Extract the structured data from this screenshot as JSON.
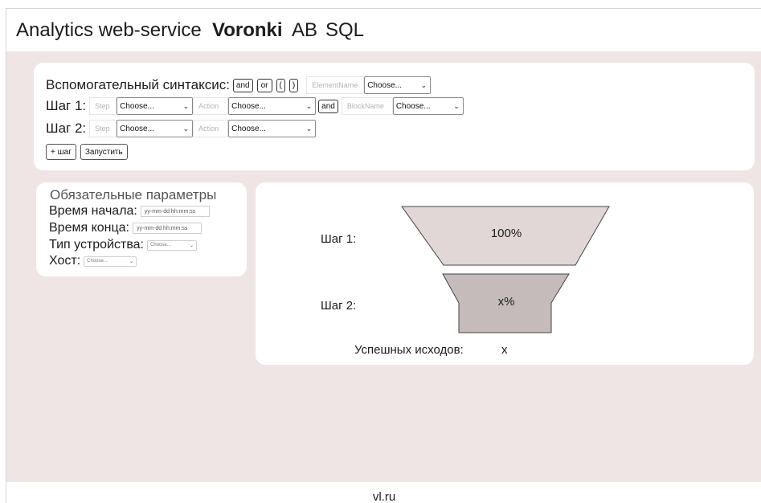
{
  "header": {
    "brand": "Analytics web-service",
    "nav": [
      {
        "label": "Voronki",
        "active": true
      },
      {
        "label": "AB",
        "active": false
      },
      {
        "label": "SQL",
        "active": false
      }
    ]
  },
  "syntax": {
    "label": "Вспомогательный синтаксис:",
    "buttons": [
      "and",
      "or",
      "(",
      ")"
    ],
    "element_placeholder": "ElementName",
    "element_select": "Choose..."
  },
  "steps": [
    {
      "label": "Шаг 1:",
      "step_placeholder": "Step",
      "step_select": "Choose...",
      "action_placeholder": "Action",
      "action_select": "Choose...",
      "connector": "and",
      "block_placeholder": "BlockName",
      "block_select": "Choose..."
    },
    {
      "label": "Шаг 2:",
      "step_placeholder": "Step",
      "step_select": "Choose...",
      "action_placeholder": "Action",
      "action_select": "Choose..."
    }
  ],
  "actions": {
    "add_step": "+ шаг",
    "run": "Запустить"
  },
  "params": {
    "title": "Обязательные параметры",
    "start_label": "Время начала:",
    "start_placeholder": "yy-mm-dd hh:mm:ss",
    "end_label": "Время конца:",
    "end_placeholder": "yy-mm-dd hh:mm:ss",
    "device_label": "Тип устройства:",
    "device_select": "Choose...",
    "host_label": "Хост:",
    "host_select": "Choose..."
  },
  "funnel": {
    "steps": [
      {
        "label": "Шаг 1:",
        "value": "100%",
        "color": "#e2d7d7"
      },
      {
        "label": "Шаг 2:",
        "value": "x%",
        "color": "#c5bbbb"
      }
    ],
    "success_label": "Успешных исходов:",
    "success_value": "x"
  },
  "footer": {
    "text": "vl.ru"
  },
  "colors": {
    "background": "#efe5e5",
    "card": "#ffffff",
    "funnel_top": "#e2d7d7",
    "funnel_bottom": "#c5bbbb"
  }
}
